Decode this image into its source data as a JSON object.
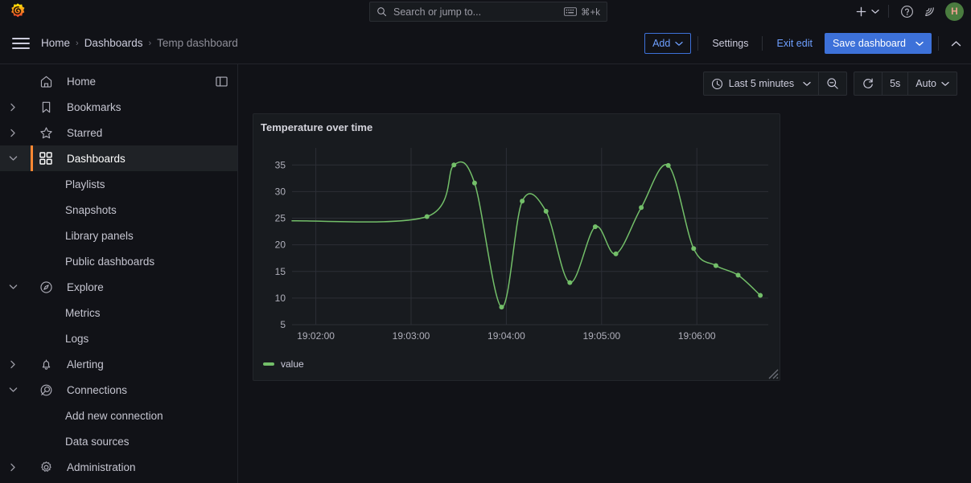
{
  "app": {
    "logo_icon": "grafana-logo"
  },
  "topbar": {
    "search": {
      "placeholder": "Search or jump to...",
      "icon": "search-icon",
      "keyboard_icon": "keyboard-icon",
      "shortcut": "⌘+k"
    },
    "actions": {
      "add_icon": "plus-icon",
      "add_chevron_icon": "chevron-down-icon",
      "help_icon": "help-circle-icon",
      "news_icon": "rss-feed-icon",
      "avatar_icon": "user-avatar",
      "avatar_initial": "H"
    }
  },
  "navbar": {
    "menu_icon": "hamburger-menu-icon",
    "breadcrumbs": [
      {
        "label": "Home"
      },
      {
        "label": "Dashboards"
      },
      {
        "label": "Temp dashboard"
      }
    ],
    "separator": "›",
    "actions": {
      "add_label": "Add",
      "add_chevron_icon": "chevron-down-icon",
      "settings_label": "Settings",
      "exit_edit_label": "Exit edit",
      "save_label": "Save dashboard",
      "save_chevron_icon": "chevron-down-icon",
      "collapse_icon": "chevron-up-icon"
    }
  },
  "sidebar": {
    "dock_icon": "dock-menu-icon",
    "items": [
      {
        "label": "Home",
        "icon": "home-icon",
        "chevron": "",
        "level": 0,
        "active": false,
        "has_dock": true
      },
      {
        "label": "Bookmarks",
        "icon": "bookmark-icon",
        "chevron": "right",
        "level": 0,
        "active": false
      },
      {
        "label": "Starred",
        "icon": "star-icon",
        "chevron": "right",
        "level": 0,
        "active": false
      },
      {
        "label": "Dashboards",
        "icon": "grid-icon",
        "chevron": "down",
        "level": 0,
        "active": true
      },
      {
        "label": "Playlists",
        "icon": "",
        "chevron": "",
        "level": 1,
        "active": false
      },
      {
        "label": "Snapshots",
        "icon": "",
        "chevron": "",
        "level": 1,
        "active": false
      },
      {
        "label": "Library panels",
        "icon": "",
        "chevron": "",
        "level": 1,
        "active": false
      },
      {
        "label": "Public dashboards",
        "icon": "",
        "chevron": "",
        "level": 1,
        "active": false
      },
      {
        "label": "Explore",
        "icon": "compass-icon",
        "chevron": "down",
        "level": 0,
        "active": false
      },
      {
        "label": "Metrics",
        "icon": "",
        "chevron": "",
        "level": 1,
        "active": false
      },
      {
        "label": "Logs",
        "icon": "",
        "chevron": "",
        "level": 1,
        "active": false
      },
      {
        "label": "Alerting",
        "icon": "bell-icon",
        "chevron": "right",
        "level": 0,
        "active": false
      },
      {
        "label": "Connections",
        "icon": "connections-icon",
        "chevron": "down",
        "level": 0,
        "active": false
      },
      {
        "label": "Add new connection",
        "icon": "",
        "chevron": "",
        "level": 1,
        "active": false
      },
      {
        "label": "Data sources",
        "icon": "",
        "chevron": "",
        "level": 1,
        "active": false
      },
      {
        "label": "Administration",
        "icon": "gear-icon",
        "chevron": "right",
        "level": 0,
        "active": false
      }
    ]
  },
  "timebar": {
    "clock_icon": "clock-icon",
    "range_label": "Last 5 minutes",
    "range_chevron_icon": "chevron-down-icon",
    "zoom_out_icon": "zoom-out-icon",
    "refresh_icon": "refresh-icon",
    "refresh_interval": "5s",
    "resolution_label": "Auto",
    "resolution_chevron_icon": "chevron-down-icon"
  },
  "panel": {
    "title": "Temperature over time",
    "resize_handle_icon": "resize-handle-icon"
  },
  "colors": {
    "series": "#73bf69",
    "accent_blue": "#3d71d9",
    "accent_orange": "#ff8833",
    "panel_bg": "#181b1f",
    "page_bg": "#111217",
    "text": "#ccccdc"
  },
  "chart_data": {
    "type": "line",
    "title": "Temperature over time",
    "xlabel": "",
    "ylabel": "",
    "ylim": [
      5,
      37
    ],
    "yticks": [
      5,
      10,
      15,
      20,
      25,
      30,
      35
    ],
    "xticks": [
      "19:02:00",
      "19:03:00",
      "19:04:00",
      "19:05:00",
      "19:06:00"
    ],
    "xlim": [
      "19:01:45",
      "19:06:45"
    ],
    "grid": true,
    "legend": {
      "position": "bottom-left",
      "entries": [
        "value"
      ]
    },
    "series": [
      {
        "name": "value",
        "color": "#73bf69",
        "show_points": true,
        "x": [
          "19:01:45",
          "19:03:10",
          "19:03:27",
          "19:03:40",
          "19:03:57",
          "19:04:10",
          "19:04:25",
          "19:04:40",
          "19:04:56",
          "19:05:09",
          "19:05:25",
          "19:05:42",
          "19:05:58",
          "19:06:12",
          "19:06:26",
          "19:06:40"
        ],
        "values": [
          24.5,
          25.3,
          35.0,
          31.6,
          8.3,
          28.2,
          26.3,
          12.9,
          23.4,
          18.3,
          27.0,
          34.9,
          19.3,
          16.1,
          14.3,
          10.5
        ],
        "first_point_marker": false
      }
    ]
  }
}
